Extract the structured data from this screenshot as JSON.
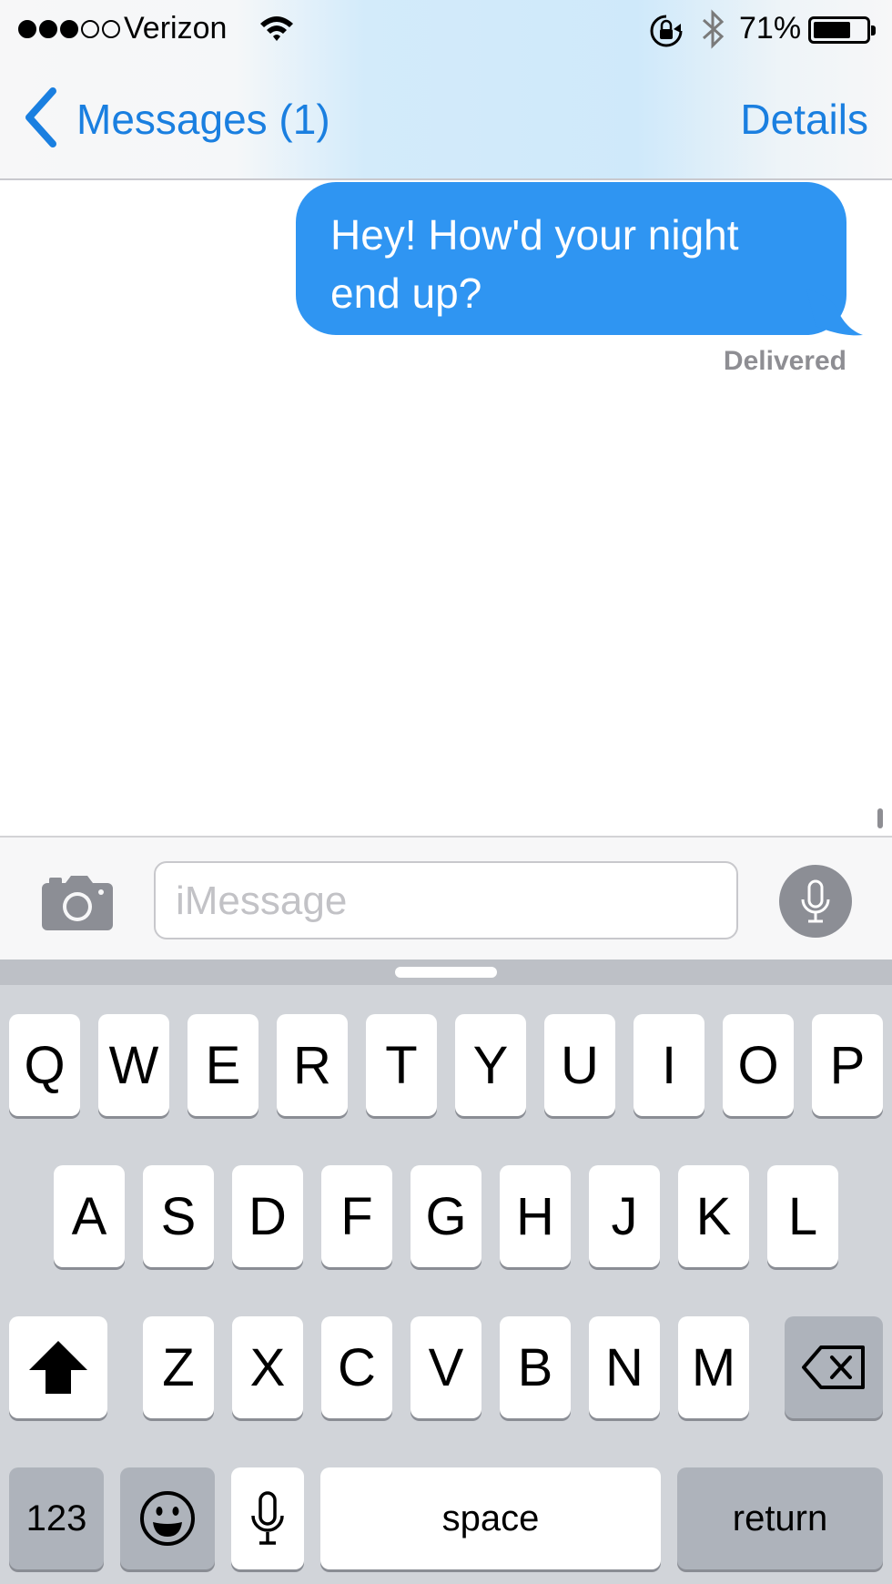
{
  "status_bar": {
    "carrier": "Verizon",
    "signal_bars_filled": 3,
    "signal_bars_total": 5,
    "battery_percent_label": "71%",
    "battery_level": 0.71,
    "icons": [
      "wifi-icon",
      "rotation-lock-icon",
      "bluetooth-icon",
      "battery-icon"
    ]
  },
  "nav": {
    "back_label": "Messages (1)",
    "details_label": "Details"
  },
  "conversation": {
    "messages": [
      {
        "direction": "outgoing",
        "text": "Hey! How'd your night end up?"
      }
    ],
    "receipt": "Delivered"
  },
  "composer": {
    "placeholder": "iMessage",
    "icons": [
      "camera-icon",
      "microphone-icon"
    ]
  },
  "keyboard": {
    "row1": [
      "Q",
      "W",
      "E",
      "R",
      "T",
      "Y",
      "U",
      "I",
      "O",
      "P"
    ],
    "row2": [
      "A",
      "S",
      "D",
      "F",
      "G",
      "H",
      "J",
      "K",
      "L"
    ],
    "row3": [
      "Z",
      "X",
      "C",
      "V",
      "B",
      "N",
      "M"
    ],
    "numbers_label": "123",
    "space_label": "space",
    "return_label": "return",
    "icons": [
      "shift-icon",
      "delete-icon",
      "emoji-icon",
      "dictation-icon"
    ]
  },
  "colors": {
    "accent": "#1a7fe0",
    "bubble": "#2f95f2",
    "keyboard_bg": "#d1d4d9"
  }
}
